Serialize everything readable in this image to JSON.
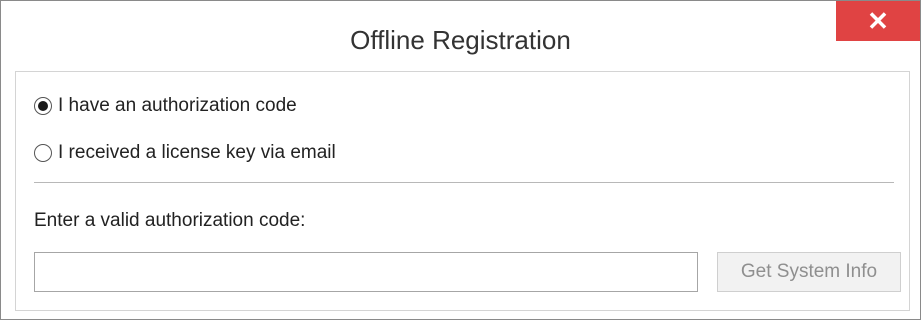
{
  "window": {
    "title": "Offline Registration",
    "close_glyph": "✕",
    "close_color": "#e04343"
  },
  "options": [
    {
      "label": "I have an authorization code",
      "selected": true
    },
    {
      "label": "I received a license key via email",
      "selected": false
    }
  ],
  "code_field": {
    "label": "Enter a valid authorization code:",
    "value": "",
    "placeholder": ""
  },
  "buttons": {
    "system_info": "Get System Info"
  }
}
